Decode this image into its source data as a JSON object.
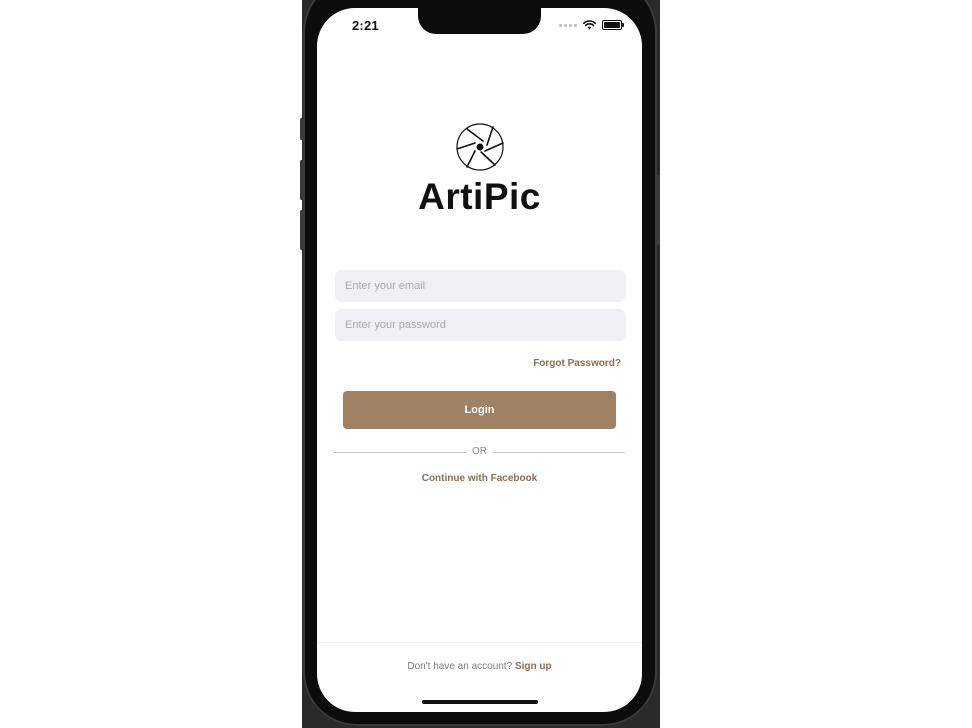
{
  "status_bar": {
    "time": "2:21"
  },
  "brand": {
    "name": "ArtiPic"
  },
  "form": {
    "email_placeholder": "Enter your email",
    "email_value": "",
    "password_placeholder": "Enter your password",
    "password_value": "",
    "forgot_label": "Forgot Password?",
    "login_label": "Login",
    "or_label": "OR",
    "facebook_label": "Continue with Facebook"
  },
  "footer": {
    "prompt": "Don't have an account?",
    "signup_label": "Sign up"
  },
  "colors": {
    "accent": "#9e8263",
    "accent_text": "#8a6f4e",
    "field_bg": "#f0eff4"
  },
  "icons": {
    "logo": "camera-aperture-icon",
    "wifi": "wifi-icon",
    "battery": "battery-icon",
    "signal": "signal-dots-icon"
  }
}
